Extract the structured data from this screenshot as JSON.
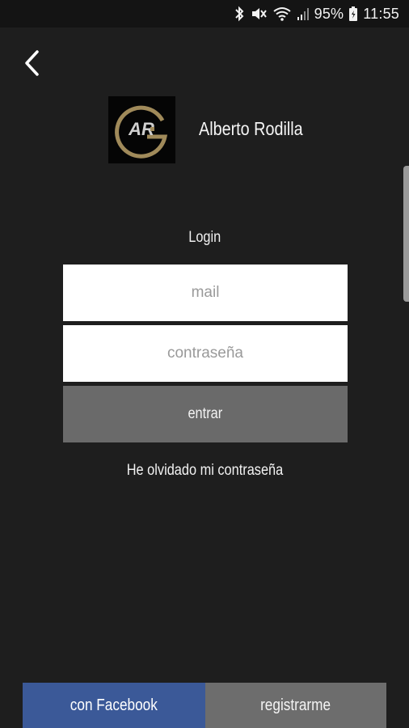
{
  "status_bar": {
    "battery": "95%",
    "time": "11:55",
    "icons": [
      "bluetooth-icon",
      "mute-icon",
      "wifi-icon",
      "signal-icon",
      "battery-icon"
    ]
  },
  "header": {
    "back_icon": "chevron-left-icon",
    "brand_name": "Alberto Rodilla",
    "logo_letters": "AR",
    "logo_accent": "#a08a5a"
  },
  "login": {
    "title": "Login",
    "mail_placeholder": "mail",
    "password_placeholder": "contraseña",
    "submit_label": "entrar",
    "forgot_label": "He olvidado mi contraseña"
  },
  "footer": {
    "facebook_label": "con Facebook",
    "register_label": "registrarme",
    "facebook_color": "#3b5998"
  }
}
